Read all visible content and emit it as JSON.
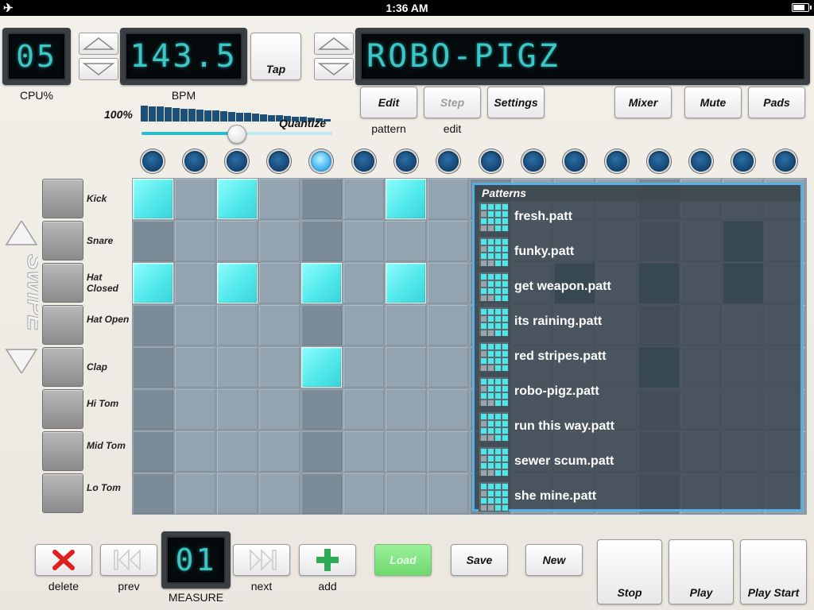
{
  "status_bar": {
    "time": "1:36 AM",
    "airplane_icon": "airplane-icon",
    "battery_icon": "battery-icon"
  },
  "cpu": {
    "display": "05",
    "label": "CPU%"
  },
  "bpm": {
    "display": "143.5",
    "label": "BPM"
  },
  "tap": {
    "label": "Tap"
  },
  "song_name": {
    "display": "ROBO-PIGZ"
  },
  "quantize": {
    "percent": "100%",
    "label": "Quantize",
    "value": 0.5
  },
  "top_buttons": {
    "edit": "Edit",
    "edit_caption": "pattern",
    "step": "Step",
    "step_caption": "edit",
    "settings": "Settings",
    "mixer": "Mixer",
    "mute": "Mute",
    "pads": "Pads"
  },
  "swipe_label": "SWIPE",
  "tracks": [
    "Kick",
    "Snare",
    "Hat Closed",
    "Hat Open",
    "Clap",
    "Hi Tom",
    "Mid Tom",
    "Lo Tom"
  ],
  "steps_count": 16,
  "current_step": 5,
  "active_cells": [
    [
      0,
      0
    ],
    [
      0,
      2
    ],
    [
      0,
      6
    ],
    [
      2,
      0
    ],
    [
      2,
      2
    ],
    [
      2,
      4
    ],
    [
      2,
      6
    ],
    [
      4,
      4
    ]
  ],
  "patterns": {
    "title": "Patterns",
    "items": [
      "fresh.patt",
      "funky.patt",
      "get weapon.patt",
      "its raining.patt",
      "red stripes.patt",
      "robo-pigz.patt",
      "run this way.patt",
      "sewer scum.patt",
      "she mine.patt"
    ]
  },
  "bottom": {
    "delete": "delete",
    "prev": "prev",
    "measure_display": "01",
    "measure_label": "MEASURE",
    "next": "next",
    "add": "add",
    "load": "Load",
    "save": "Save",
    "new": "New",
    "stop": "Stop",
    "play": "Play",
    "play_start": "Play Start"
  },
  "colors": {
    "lcd_text": "#3cc7c7",
    "active_cell": "#4ee7ea",
    "led_on": "#49b8f2",
    "patterns_border": "#58aee0",
    "load_button": "#6fd86f",
    "delete_x": "#e02020",
    "add_plus": "#2faa55"
  }
}
